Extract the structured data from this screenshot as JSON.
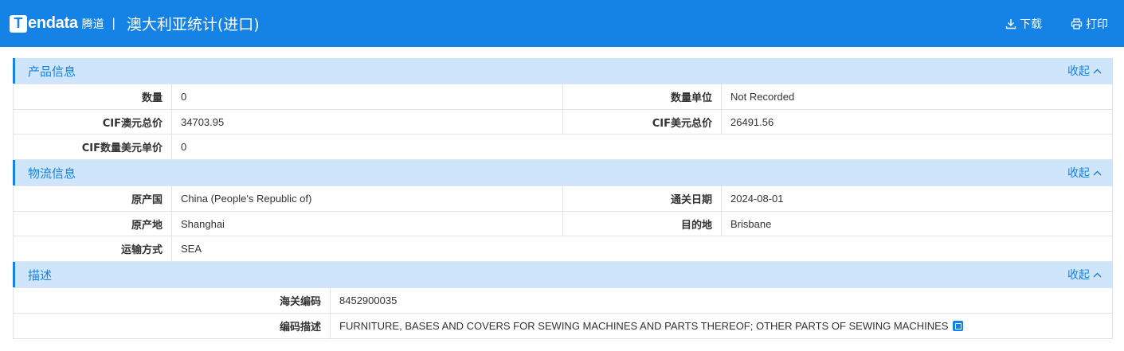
{
  "header": {
    "logo_mark": "T",
    "logo_text": "endata",
    "logo_cn": "腾道",
    "separator": "|",
    "title": "澳大利亚统计(进口)",
    "download_label": "下载",
    "print_label": "打印"
  },
  "sections": {
    "product": {
      "title": "产品信息",
      "collapse_label": "收起",
      "rows": [
        {
          "l1": "数量",
          "v1": "0",
          "l2": "数量单位",
          "v2": "Not Recorded"
        },
        {
          "l1": "CIF澳元总价",
          "v1": "34703.95",
          "l2": "CIF美元总价",
          "v2": "26491.56"
        },
        {
          "l1": "CIF数量美元单价",
          "v1": "0"
        }
      ]
    },
    "logistics": {
      "title": "物流信息",
      "collapse_label": "收起",
      "rows": [
        {
          "l1": "原产国",
          "v1": "China (People's Republic of)",
          "l2": "通关日期",
          "v2": "2024-08-01"
        },
        {
          "l1": "原产地",
          "v1": "Shanghai",
          "l2": "目的地",
          "v2": "Brisbane"
        },
        {
          "l1": "运输方式",
          "v1": "SEA"
        }
      ]
    },
    "description": {
      "title": "描述",
      "collapse_label": "收起",
      "rows": [
        {
          "l1": "海关编码",
          "v1": "8452900035"
        },
        {
          "l1": "编码描述",
          "v1": "FURNITURE, BASES AND COVERS FOR SEWING MACHINES AND PARTS THEREOF; OTHER PARTS OF SEWING MACHINES"
        }
      ]
    }
  },
  "colors": {
    "accent": "#1582e6",
    "section_bg": "#cfe5fb",
    "border": "#e1e4e8"
  }
}
